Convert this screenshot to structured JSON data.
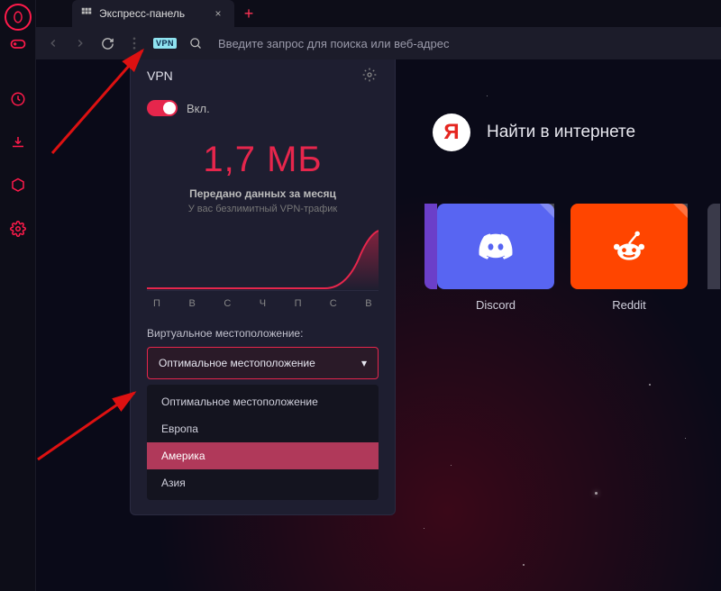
{
  "tab": {
    "title": "Экспресс-панель",
    "close": "×",
    "new": "+"
  },
  "vpn_badge": "VPN",
  "address_placeholder": "Введите запрос для поиска или веб-адрес",
  "hero": {
    "y": "Я",
    "text": "Найти в интернете"
  },
  "dials": [
    {
      "label": "Discord"
    },
    {
      "label": "Reddit"
    }
  ],
  "vpn": {
    "title": "VPN",
    "toggle_label": "Вкл.",
    "usage": "1,7 МБ",
    "usage_sub1": "Передано данных за месяц",
    "usage_sub2": "У вас безлимитный VPN-трафик",
    "days": [
      "П",
      "В",
      "С",
      "Ч",
      "П",
      "С",
      "В"
    ],
    "loc_label": "Виртуальное местоположение:",
    "loc_selected": "Оптимальное местоположение",
    "loc_caret": "▾",
    "loc_options": [
      "Оптимальное местоположение",
      "Европа",
      "Америка",
      "Азия"
    ],
    "highlighted_idx": 2
  },
  "chart_data": {
    "type": "line",
    "categories": [
      "П",
      "В",
      "С",
      "Ч",
      "П",
      "С",
      "В"
    ],
    "values": [
      0,
      0,
      0,
      0,
      0,
      0,
      1.7
    ],
    "title": "",
    "xlabel": "",
    "ylabel": "МБ",
    "ylim": [
      0,
      1.7
    ]
  }
}
